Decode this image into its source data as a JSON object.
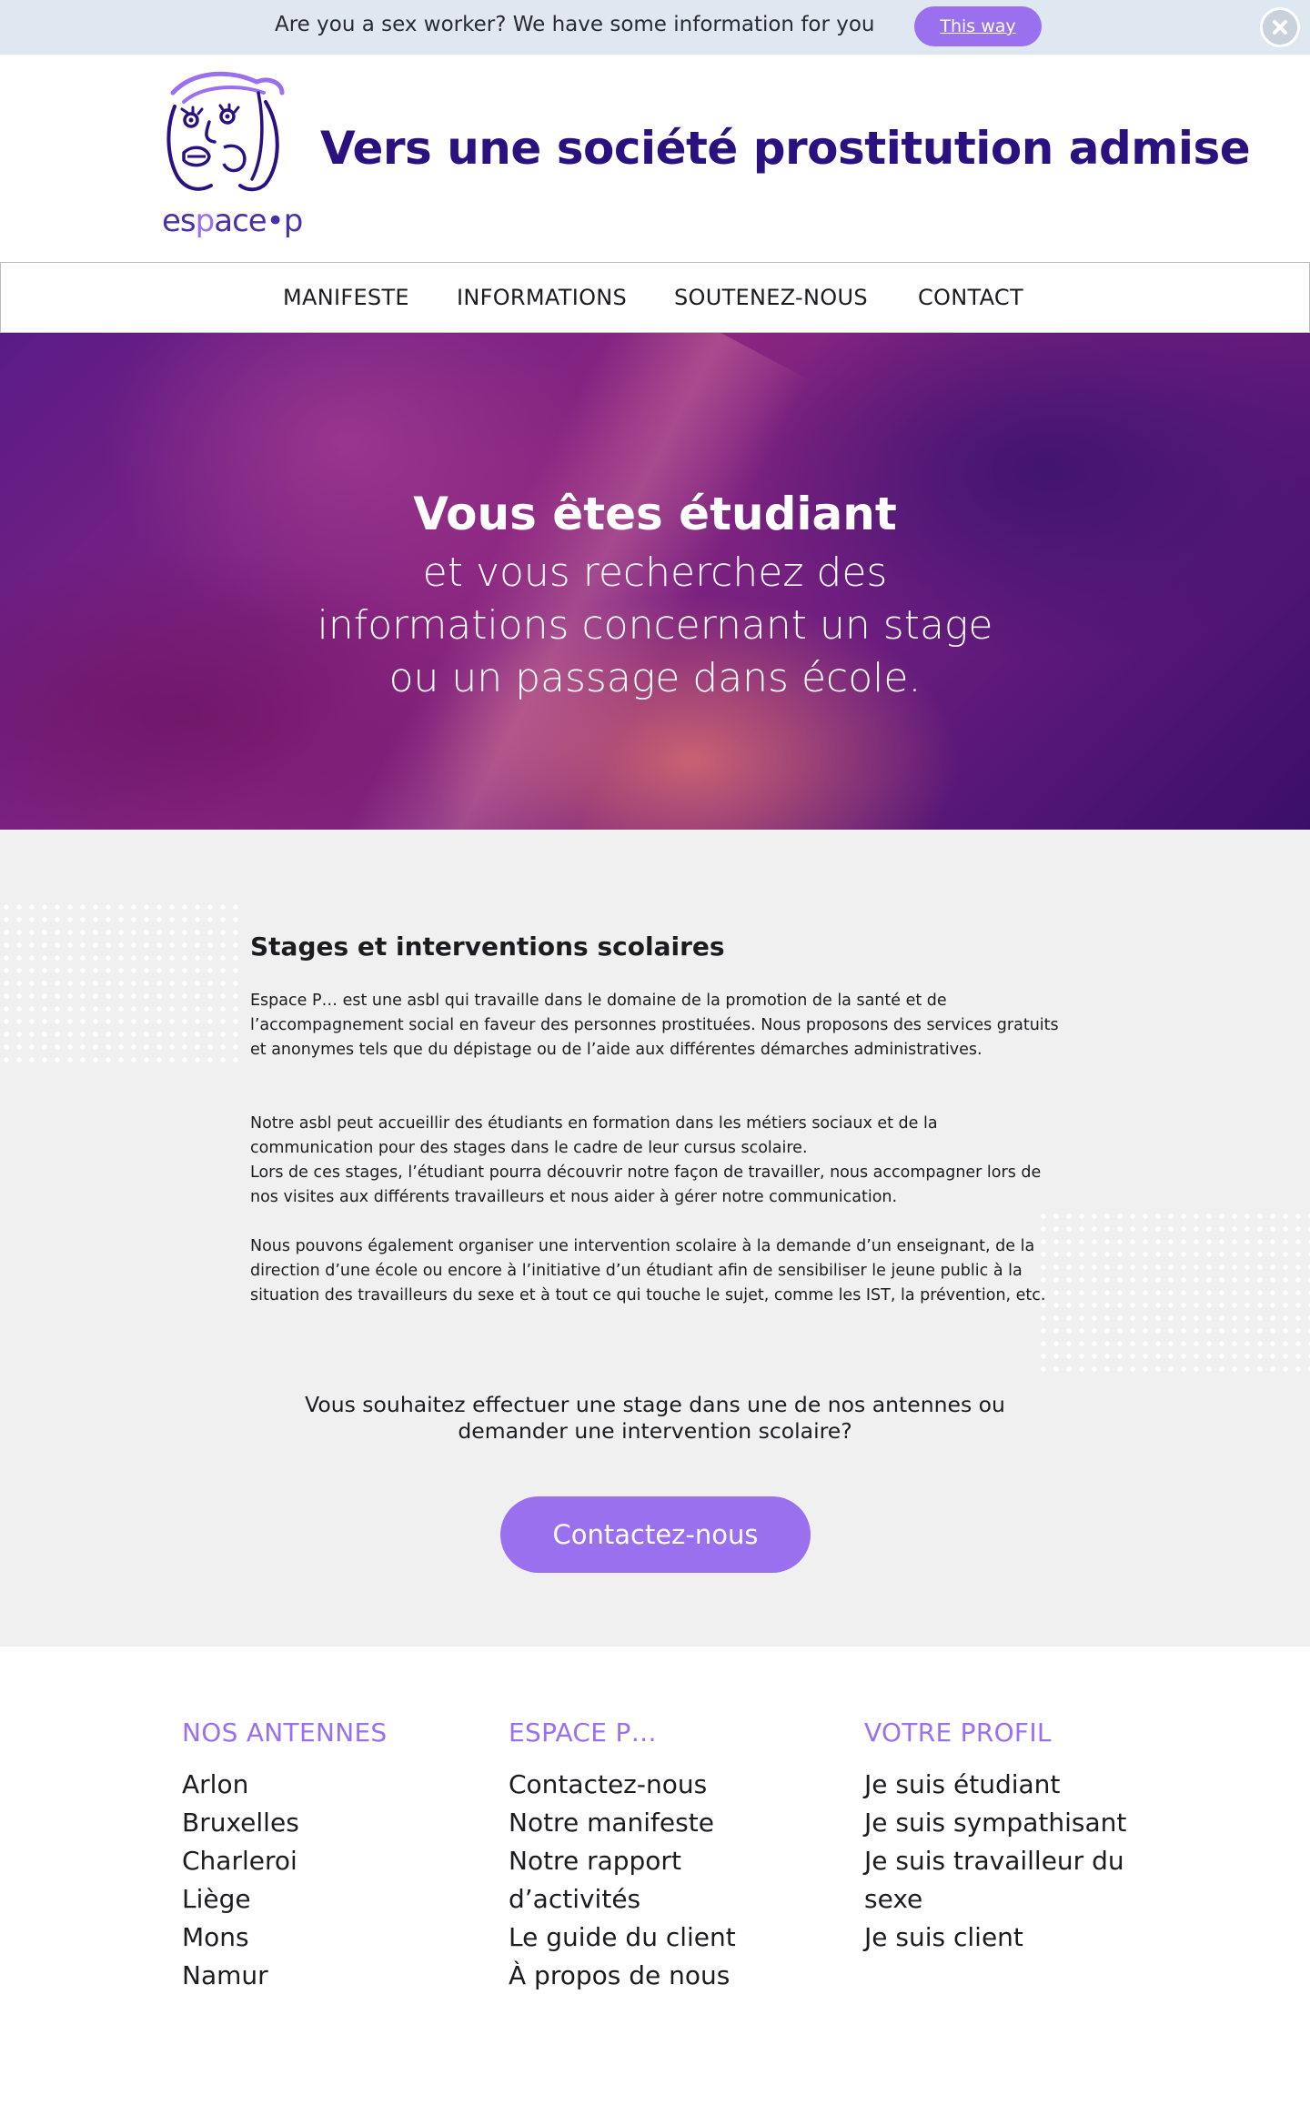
{
  "notice": {
    "text": "Are you a sex worker? We have some information for you",
    "button_label": "This way",
    "close_icon": "close-icon"
  },
  "header": {
    "logo_word_start": "es",
    "logo_word_accent": "p",
    "logo_word_end": "ace•p",
    "title": "Vers une société prostitution admise"
  },
  "nav": {
    "items": [
      "MANIFESTE",
      "INFORMATIONS",
      "SOUTENEZ-NOUS",
      "CONTACT"
    ]
  },
  "hero": {
    "title": "Vous êtes étudiant",
    "lines": [
      "et vous recherchez des",
      "informations concernant un stage",
      "ou un passage dans école."
    ]
  },
  "main": {
    "section_title": "Stages et interventions scolaires",
    "paragraphs": [
      "Espace P… est une asbl qui travaille dans le domaine de la promotion de la santé et de l’accompagnement social en faveur des personnes prostituées. Nous proposons des services gratuits et anonymes tels que du dépistage ou de l’aide aux différentes démarches administratives.",
      "Notre asbl peut accueillir des étudiants en formation dans les métiers sociaux et de la communication pour des stages dans le cadre de leur cursus scolaire.",
      "Lors de ces stages, l’étudiant pourra découvrir notre façon de travailler, nous accompagner lors de nos visites aux différents travailleurs et nous aider à gérer notre communication.",
      "Nous pouvons également organiser une intervention scolaire à la demande d’un enseignant, de la direction d’une école ou encore à l’initiative d’un étudiant afin de sensibiliser le jeune public à la situation des travailleurs du sexe et à tout ce qui touche le sujet, comme les IST, la prévention, etc."
    ],
    "cta_question_line1": "Vous souhaitez effectuer une stage dans une de nos antennes ou",
    "cta_question_line2": "demander une intervention scolaire?",
    "cta_button": "Contactez-nous"
  },
  "footer": {
    "columns": [
      {
        "heading": "NOS ANTENNES",
        "links": [
          "Arlon",
          "Bruxelles",
          "Charleroi",
          "Liège",
          "Mons",
          "Namur"
        ]
      },
      {
        "heading": "ESPACE P…",
        "links": [
          "Contactez-nous",
          "Notre manifeste",
          "Notre rapport",
          "d’activités",
          "Le guide du client",
          "À propos de nous"
        ]
      },
      {
        "heading": "VOTRE PROFIL",
        "links": [
          "Je suis étudiant",
          "Je suis sympathisant",
          "Je suis travailleur du",
          "sexe",
          "Je suis client"
        ]
      }
    ]
  },
  "colors": {
    "accent": "#9a70ef",
    "brand_dark": "#2b1180",
    "notice_bg": "#dfe7f1",
    "content_bg": "#f0f0f0"
  }
}
